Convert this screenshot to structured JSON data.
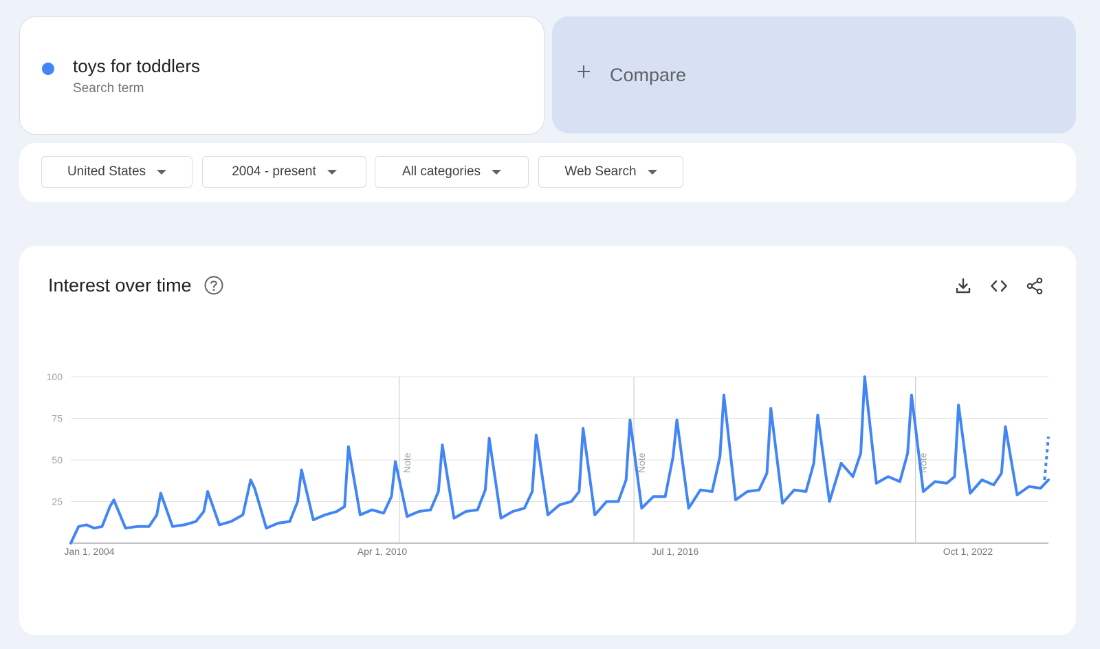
{
  "search_term": {
    "term": "toys for toddlers",
    "subtitle": "Search term",
    "dot_color": "#4285f4"
  },
  "compare": {
    "label": "Compare",
    "icon": "plus-icon"
  },
  "filters": {
    "region": "United States",
    "time_range": "2004 - present",
    "category": "All categories",
    "search_type": "Web Search"
  },
  "chart_panel": {
    "title": "Interest over time",
    "help_icon": "help-circle-icon",
    "tools": [
      "download-icon",
      "embed-code-icon",
      "share-icon"
    ]
  },
  "chart_data": {
    "type": "line",
    "title": "Interest over time",
    "xlabel": "",
    "ylabel": "",
    "ylim": [
      0,
      100
    ],
    "y_ticks": [
      100,
      75,
      50,
      25
    ],
    "x_tick_labels": [
      "Jan 1, 2004",
      "Apr 1, 2010",
      "Jul 1, 2016",
      "Oct 1, 2022"
    ],
    "x_range": [
      "2004-01",
      "2024-11"
    ],
    "notes": [
      {
        "x": "2011-01",
        "label": "Note"
      },
      {
        "x": "2016-01",
        "label": "Note"
      },
      {
        "x": "2022-01",
        "label": "Note"
      }
    ],
    "color": "#4285f4",
    "grid": true,
    "x": [
      "2004-01",
      "2004-03",
      "2004-05",
      "2004-07",
      "2004-09",
      "2004-11",
      "2004-12",
      "2005-03",
      "2005-06",
      "2005-09",
      "2005-11",
      "2005-12",
      "2006-03",
      "2006-06",
      "2006-09",
      "2006-11",
      "2006-12",
      "2007-03",
      "2007-06",
      "2007-09",
      "2007-11",
      "2007-12",
      "2008-03",
      "2008-06",
      "2008-09",
      "2008-11",
      "2008-12",
      "2009-03",
      "2009-06",
      "2009-09",
      "2009-11",
      "2009-12",
      "2010-03",
      "2010-06",
      "2010-09",
      "2010-11",
      "2010-12",
      "2011-03",
      "2011-06",
      "2011-09",
      "2011-11",
      "2011-12",
      "2012-03",
      "2012-06",
      "2012-09",
      "2012-11",
      "2012-12",
      "2013-03",
      "2013-06",
      "2013-09",
      "2013-11",
      "2013-12",
      "2014-03",
      "2014-06",
      "2014-09",
      "2014-11",
      "2014-12",
      "2015-03",
      "2015-06",
      "2015-09",
      "2015-11",
      "2015-12",
      "2016-03",
      "2016-06",
      "2016-09",
      "2016-11",
      "2016-12",
      "2017-03",
      "2017-06",
      "2017-09",
      "2017-11",
      "2017-12",
      "2018-03",
      "2018-06",
      "2018-09",
      "2018-11",
      "2018-12",
      "2019-03",
      "2019-06",
      "2019-09",
      "2019-11",
      "2019-12",
      "2020-03",
      "2020-06",
      "2020-09",
      "2020-11",
      "2020-12",
      "2021-03",
      "2021-06",
      "2021-09",
      "2021-11",
      "2021-12",
      "2022-03",
      "2022-06",
      "2022-09",
      "2022-11",
      "2022-12",
      "2023-03",
      "2023-06",
      "2023-09",
      "2023-11",
      "2023-12",
      "2024-03",
      "2024-06",
      "2024-09",
      "2024-11"
    ],
    "series": [
      {
        "values": [
          0,
          10,
          11,
          9,
          10,
          22,
          26,
          9,
          10,
          10,
          17,
          30,
          10,
          11,
          13,
          19,
          31,
          11,
          13,
          17,
          38,
          33,
          9,
          12,
          13,
          25,
          44,
          14,
          17,
          19,
          22,
          58,
          17,
          20,
          18,
          28,
          49,
          16,
          19,
          20,
          31,
          59,
          15,
          19,
          20,
          32,
          63,
          15,
          19,
          21,
          31,
          65,
          17,
          23,
          25,
          31,
          69,
          17,
          25,
          25,
          38,
          74,
          21,
          28,
          28,
          52,
          74,
          21,
          32,
          31,
          52,
          89,
          26,
          31,
          32,
          42,
          81,
          24,
          32,
          31,
          48,
          77,
          25,
          48,
          40,
          54,
          100,
          36,
          40,
          37,
          54,
          89,
          31,
          37,
          36,
          40,
          83,
          30,
          38,
          35,
          42,
          70,
          29,
          34,
          33,
          38
        ]
      }
    ],
    "projection": {
      "x": [
        "2024-10",
        "2024-11"
      ],
      "values": [
        38,
        64
      ]
    }
  }
}
